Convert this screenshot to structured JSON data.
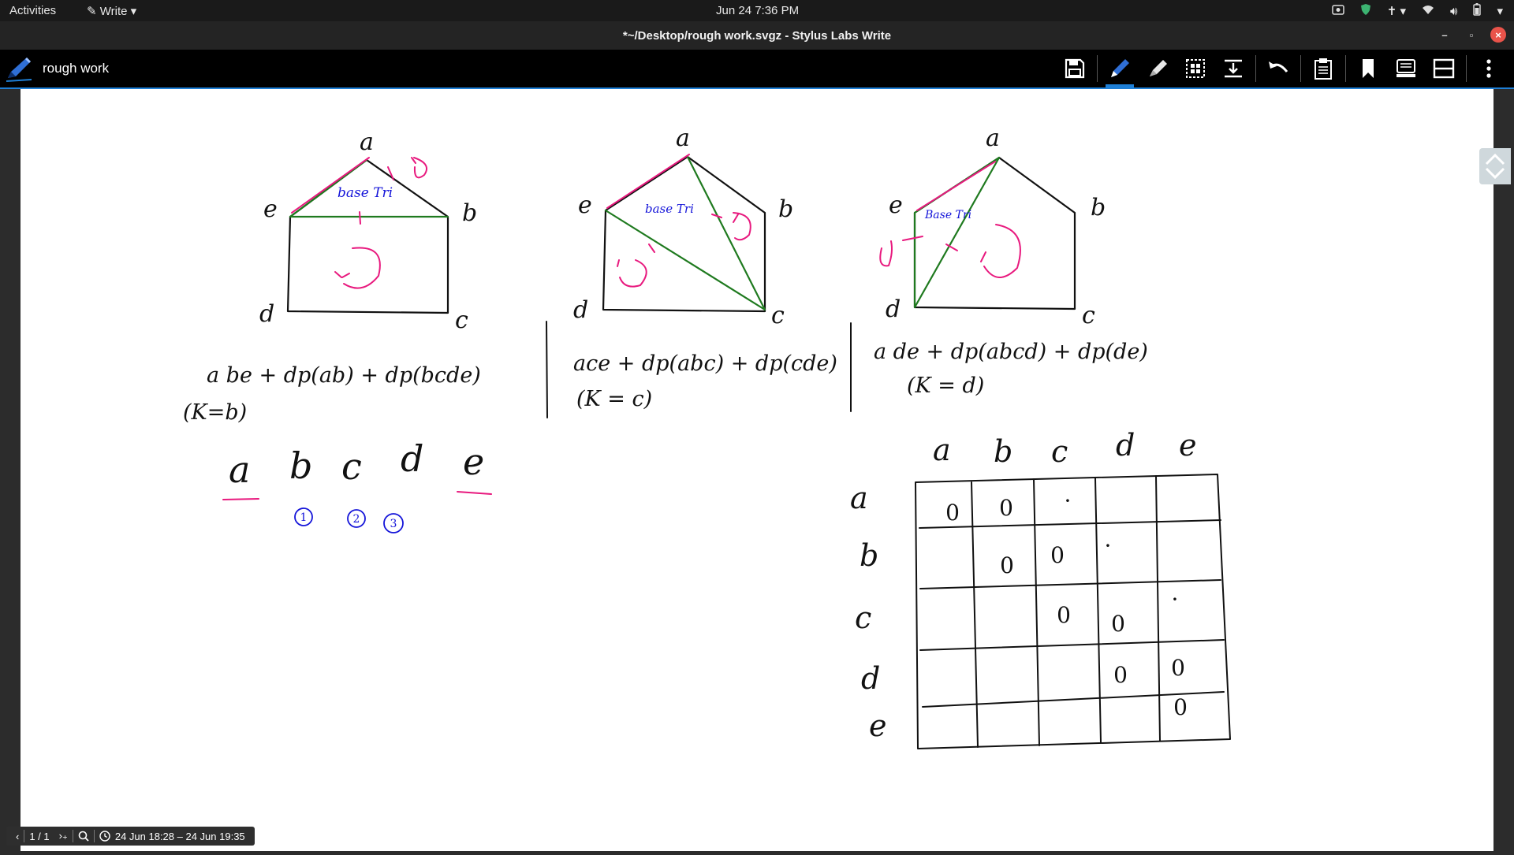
{
  "system_bar": {
    "activities": "Activities",
    "app_menu": "Write",
    "datetime": "Jun 24  7:36 PM"
  },
  "window": {
    "title": "*~/Desktop/rough work.svgz - Stylus Labs Write"
  },
  "toolbar": {
    "doc_title": "rough work",
    "tools": [
      "save",
      "pen",
      "eraser",
      "selection",
      "insert-space",
      "undo",
      "clipboard",
      "bookmark",
      "pages",
      "layout",
      "more"
    ]
  },
  "statusbar": {
    "page": "1 / 1",
    "timestamp": "24 Jun 18:28 – 24 Jun 19:35"
  },
  "colors": {
    "ink_black": "#111111",
    "ink_pink": "#e8197e",
    "ink_green": "#1f7a1f",
    "ink_blue": "#1414d9",
    "accent": "#1e7fd6"
  },
  "notes": {
    "vertex_a": "a",
    "vertex_b": "b",
    "vertex_c": "c",
    "vertex_d": "d",
    "vertex_e": "e",
    "base_tri": "base Tri",
    "base_tri_2": "base Tri",
    "base_tri_3": "Base Tri",
    "expr1": "a be + dp(ab) + dp(bcde)",
    "cond1": "(K=b)",
    "expr2": "ace + dp(abc) + dp(cde)",
    "cond2": "(K = c)",
    "expr3": "a de + dp(abcd) + dp(de)",
    "cond3": "(K = d)",
    "letters": [
      "a",
      "b",
      "c",
      "d",
      "e"
    ],
    "circled": [
      "1",
      "2",
      "3"
    ]
  },
  "table": {
    "col_headers": [
      "a",
      "b",
      "c",
      "d",
      "e"
    ],
    "row_headers": [
      "a",
      "b",
      "c",
      "d",
      "e"
    ],
    "cells": [
      [
        "0",
        "0",
        "·",
        "",
        ""
      ],
      [
        "",
        "0",
        "0",
        "·",
        ""
      ],
      [
        "",
        "",
        "0",
        "0",
        "·"
      ],
      [
        "",
        "",
        "",
        "0",
        "0"
      ],
      [
        "",
        "",
        "",
        "",
        "0"
      ]
    ]
  }
}
